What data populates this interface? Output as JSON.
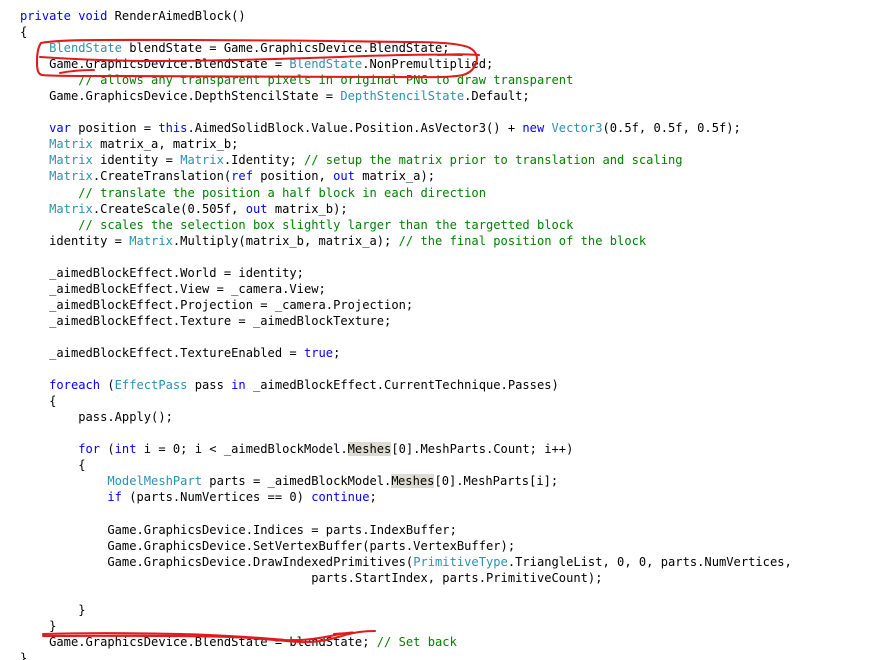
{
  "editor": {
    "language": "C#",
    "background_color": "#ffffff",
    "syntax_colors": {
      "keyword": "#0000ff",
      "type": "#2b91af",
      "comment": "#008000",
      "plain": "#000000",
      "selection_highlight": "#dcdcd2"
    },
    "caret": {
      "line_index": 29,
      "after_text": "ModelMeshPart parts = _aimedBlockModel.M"
    },
    "lines": [
      {
        "indent": 0,
        "tokens": [
          {
            "t": "private",
            "c": "kw"
          },
          {
            "t": " ",
            "c": "plain"
          },
          {
            "t": "void",
            "c": "kw"
          },
          {
            "t": " RenderAimedBlock()",
            "c": "plain"
          }
        ]
      },
      {
        "indent": 0,
        "tokens": [
          {
            "t": "{",
            "c": "plain"
          }
        ]
      },
      {
        "indent": 1,
        "tokens": [
          {
            "t": "BlendState",
            "c": "type"
          },
          {
            "t": " blendState = Game.GraphicsDevice.BlendState;",
            "c": "plain"
          }
        ]
      },
      {
        "indent": 1,
        "tokens": [
          {
            "t": "Game.GraphicsDevice.BlendState = ",
            "c": "plain"
          },
          {
            "t": "BlendState",
            "c": "type"
          },
          {
            "t": ".NonPremultiplied;",
            "c": "plain"
          }
        ]
      },
      {
        "indent": 2,
        "tokens": [
          {
            "t": "// allows any transparent pixels in original PNG to draw transparent",
            "c": "comment"
          }
        ]
      },
      {
        "indent": 1,
        "tokens": [
          {
            "t": "Game.GraphicsDevice.DepthStencilState = ",
            "c": "plain"
          },
          {
            "t": "DepthStencilState",
            "c": "type"
          },
          {
            "t": ".Default;",
            "c": "plain"
          }
        ]
      },
      {
        "indent": 0,
        "tokens": [
          {
            "t": "",
            "c": "plain"
          }
        ]
      },
      {
        "indent": 1,
        "tokens": [
          {
            "t": "var",
            "c": "kw"
          },
          {
            "t": " position = ",
            "c": "plain"
          },
          {
            "t": "this",
            "c": "kw"
          },
          {
            "t": ".AimedSolidBlock.Value.Position.AsVector3() + ",
            "c": "plain"
          },
          {
            "t": "new",
            "c": "kw"
          },
          {
            "t": " ",
            "c": "plain"
          },
          {
            "t": "Vector3",
            "c": "type"
          },
          {
            "t": "(0.5f, 0.5f, 0.5f);",
            "c": "plain"
          }
        ]
      },
      {
        "indent": 1,
        "tokens": [
          {
            "t": "Matrix",
            "c": "type"
          },
          {
            "t": " matrix_a, matrix_b;",
            "c": "plain"
          }
        ]
      },
      {
        "indent": 1,
        "tokens": [
          {
            "t": "Matrix",
            "c": "type"
          },
          {
            "t": " identity = ",
            "c": "plain"
          },
          {
            "t": "Matrix",
            "c": "type"
          },
          {
            "t": ".Identity; ",
            "c": "plain"
          },
          {
            "t": "// setup the matrix prior to translation and scaling",
            "c": "comment"
          }
        ]
      },
      {
        "indent": 1,
        "tokens": [
          {
            "t": "Matrix",
            "c": "type"
          },
          {
            "t": ".CreateTranslation(",
            "c": "plain"
          },
          {
            "t": "ref",
            "c": "kw"
          },
          {
            "t": " position, ",
            "c": "plain"
          },
          {
            "t": "out",
            "c": "kw"
          },
          {
            "t": " matrix_a);",
            "c": "plain"
          }
        ]
      },
      {
        "indent": 2,
        "tokens": [
          {
            "t": "// translate the position a half block in each direction",
            "c": "comment"
          }
        ]
      },
      {
        "indent": 1,
        "tokens": [
          {
            "t": "Matrix",
            "c": "type"
          },
          {
            "t": ".CreateScale(0.505f, ",
            "c": "plain"
          },
          {
            "t": "out",
            "c": "kw"
          },
          {
            "t": " matrix_b);",
            "c": "plain"
          }
        ]
      },
      {
        "indent": 2,
        "tokens": [
          {
            "t": "// scales the selection box slightly larger than the targetted block",
            "c": "comment"
          }
        ]
      },
      {
        "indent": 1,
        "tokens": [
          {
            "t": "identity = ",
            "c": "plain"
          },
          {
            "t": "Matrix",
            "c": "type"
          },
          {
            "t": ".Multiply(matrix_b, matrix_a); ",
            "c": "plain"
          },
          {
            "t": "// the final position of the block",
            "c": "comment"
          }
        ]
      },
      {
        "indent": 0,
        "tokens": [
          {
            "t": "",
            "c": "plain"
          }
        ]
      },
      {
        "indent": 1,
        "tokens": [
          {
            "t": "_aimedBlockEffect.World = identity;",
            "c": "plain"
          }
        ]
      },
      {
        "indent": 1,
        "tokens": [
          {
            "t": "_aimedBlockEffect.View = _camera.View;",
            "c": "plain"
          }
        ]
      },
      {
        "indent": 1,
        "tokens": [
          {
            "t": "_aimedBlockEffect.Projection = _camera.Projection;",
            "c": "plain"
          }
        ]
      },
      {
        "indent": 1,
        "tokens": [
          {
            "t": "_aimedBlockEffect.Texture = _aimedBlockTexture;",
            "c": "plain"
          }
        ]
      },
      {
        "indent": 0,
        "tokens": [
          {
            "t": "",
            "c": "plain"
          }
        ]
      },
      {
        "indent": 1,
        "tokens": [
          {
            "t": "_aimedBlockEffect.TextureEnabled = ",
            "c": "plain"
          },
          {
            "t": "true",
            "c": "kw"
          },
          {
            "t": ";",
            "c": "plain"
          }
        ]
      },
      {
        "indent": 0,
        "tokens": [
          {
            "t": "",
            "c": "plain"
          }
        ]
      },
      {
        "indent": 1,
        "tokens": [
          {
            "t": "foreach",
            "c": "kw"
          },
          {
            "t": " (",
            "c": "plain"
          },
          {
            "t": "EffectPass",
            "c": "type"
          },
          {
            "t": " pass ",
            "c": "plain"
          },
          {
            "t": "in",
            "c": "kw"
          },
          {
            "t": " _aimedBlockEffect.CurrentTechnique.Passes)",
            "c": "plain"
          }
        ]
      },
      {
        "indent": 1,
        "tokens": [
          {
            "t": "{",
            "c": "plain"
          }
        ]
      },
      {
        "indent": 2,
        "tokens": [
          {
            "t": "pass.Apply();",
            "c": "plain"
          }
        ]
      },
      {
        "indent": 0,
        "tokens": [
          {
            "t": "",
            "c": "plain"
          }
        ]
      },
      {
        "indent": 2,
        "tokens": [
          {
            "t": "for",
            "c": "kw"
          },
          {
            "t": " (",
            "c": "plain"
          },
          {
            "t": "int",
            "c": "kw"
          },
          {
            "t": " i = 0; i < _aimedBlockModel.",
            "c": "plain"
          },
          {
            "t": "Meshes",
            "c": "sel"
          },
          {
            "t": "[0].MeshParts.Count; i++)",
            "c": "plain"
          }
        ]
      },
      {
        "indent": 2,
        "tokens": [
          {
            "t": "{",
            "c": "plain"
          }
        ]
      },
      {
        "indent": 3,
        "tokens": [
          {
            "t": "ModelMeshPart",
            "c": "type"
          },
          {
            "t": " parts = _aimedBlockModel.",
            "c": "plain"
          },
          {
            "t": "M",
            "c": "sel"
          },
          {
            "t": "|CARET|",
            "c": "caret"
          },
          {
            "t": "eshes",
            "c": "sel"
          },
          {
            "t": "[0].MeshParts[i];",
            "c": "plain"
          }
        ]
      },
      {
        "indent": 3,
        "tokens": [
          {
            "t": "if",
            "c": "kw"
          },
          {
            "t": " (parts.NumVertices == 0) ",
            "c": "plain"
          },
          {
            "t": "continue",
            "c": "kw"
          },
          {
            "t": ";",
            "c": "plain"
          }
        ]
      },
      {
        "indent": 0,
        "tokens": [
          {
            "t": "",
            "c": "plain"
          }
        ]
      },
      {
        "indent": 3,
        "tokens": [
          {
            "t": "Game.GraphicsDevice.Indices = parts.IndexBuffer;",
            "c": "plain"
          }
        ]
      },
      {
        "indent": 3,
        "tokens": [
          {
            "t": "Game.GraphicsDevice.SetVertexBuffer(parts.VertexBuffer);",
            "c": "plain"
          }
        ]
      },
      {
        "indent": 3,
        "tokens": [
          {
            "t": "Game.GraphicsDevice.DrawIndexedPrimitives(",
            "c": "plain"
          },
          {
            "t": "PrimitiveType",
            "c": "type"
          },
          {
            "t": ".TriangleList, 0, 0, parts.NumVertices,",
            "c": "plain"
          }
        ]
      },
      {
        "indent": 0,
        "tokens": [
          {
            "t": "                                        parts.StartIndex, parts.PrimitiveCount);",
            "c": "plain"
          }
        ]
      },
      {
        "indent": 0,
        "tokens": [
          {
            "t": "",
            "c": "plain"
          }
        ]
      },
      {
        "indent": 2,
        "tokens": [
          {
            "t": "}",
            "c": "plain"
          }
        ]
      },
      {
        "indent": 1,
        "tokens": [
          {
            "t": "}",
            "c": "plain"
          }
        ]
      },
      {
        "indent": 1,
        "tokens": [
          {
            "t": "Game.GraphicsDevice.BlendState = blendState; ",
            "c": "plain"
          },
          {
            "t": "// Set back",
            "c": "comment"
          }
        ]
      },
      {
        "indent": 0,
        "tokens": [
          {
            "t": "}",
            "c": "plain"
          }
        ]
      }
    ]
  },
  "annotations": {
    "color": "#e01b1b",
    "items": [
      {
        "name": "red-box-blendstate-capture",
        "shape": "hand-drawn-rounded-box",
        "label": "Encircles: BlendState blendState = Game.GraphicsDevice.BlendState; and Game.GraphicsDevice.BlendState = BlendState.NonPremultiplied;"
      },
      {
        "name": "red-underline-blendstate-restore",
        "shape": "hand-drawn-underline",
        "label": "Underlines: Game.GraphicsDevice.BlendState = blendState; // Set back"
      }
    ]
  }
}
